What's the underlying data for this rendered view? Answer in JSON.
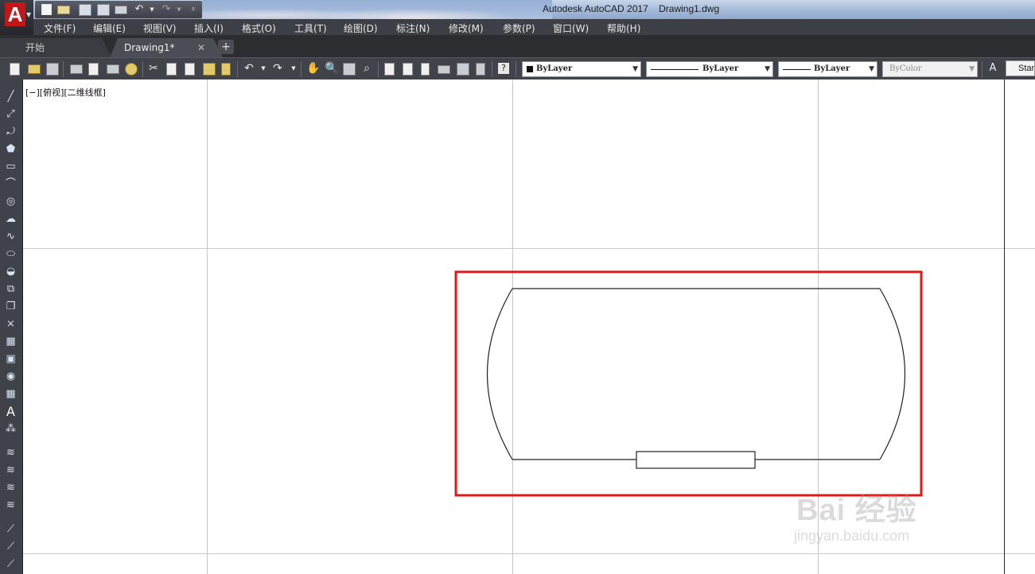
{
  "window": {
    "title_app": "Autodesk AutoCAD 2017",
    "title_file": "Drawing1.dwg",
    "logo_letter": "A"
  },
  "menu": [
    "文件(F)",
    "编辑(E)",
    "视图(V)",
    "插入(I)",
    "格式(O)",
    "工具(T)",
    "绘图(D)",
    "标注(N)",
    "修改(M)",
    "参数(P)",
    "窗口(W)",
    "帮助(H)"
  ],
  "tabs": {
    "start": "开始",
    "drawing": "Drawing1*",
    "close_glyph": "✕",
    "add_glyph": "+"
  },
  "properties": {
    "color": "ByLayer",
    "linetype": "ByLayer",
    "lineweight": "ByLayer",
    "plotstyle": "ByColor",
    "text_style": "Stan"
  },
  "viewport": {
    "label": "[−][俯视][二维线框]"
  },
  "drawing": {
    "highlight_color": "#e01818",
    "line_color": "#222222"
  },
  "watermark": {
    "brand": "Bai 经验",
    "url": "jingyan.baidu.com"
  },
  "icons": {
    "left_toolbar": [
      "line-icon",
      "construction-line-icon",
      "polyline-icon",
      "polygon-icon",
      "rectangle-icon",
      "arc-icon",
      "circle-icon",
      "revision-cloud-icon",
      "spline-icon",
      "ellipse-icon",
      "ellipse-arc-icon",
      "insert-block-icon",
      "make-block-icon",
      "point-icon",
      "hatch-icon",
      "gradient-icon",
      "region-icon",
      "table-icon",
      "multiline-text-icon",
      "add-selected-icon"
    ]
  }
}
